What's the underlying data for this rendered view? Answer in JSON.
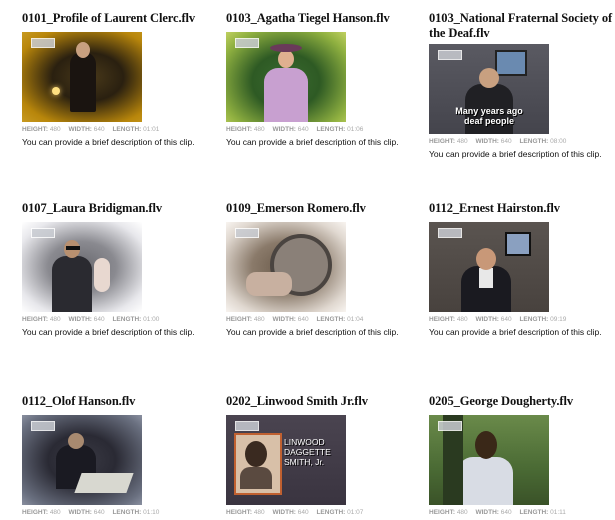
{
  "labels": {
    "height": "HEIGHT:",
    "width": "WIDTH:",
    "length": "LENGTH:"
  },
  "clips": [
    {
      "title": "0101_Profile of Laurent Clerc.flv",
      "height": "480",
      "width": "640",
      "length": "01:01",
      "description": "You can provide a brief description of this clip.",
      "caption": ""
    },
    {
      "title": "0103_Agatha Tiegel Hanson.flv",
      "height": "480",
      "width": "640",
      "length": "01:06",
      "description": "You can provide a brief description of this clip.",
      "caption": ""
    },
    {
      "title": "0103_National Fraternal Society of the Deaf.flv",
      "height": "480",
      "width": "640",
      "length": "08:00",
      "description": "You can provide a brief description of this clip.",
      "caption": "Many years ago deaf people"
    },
    {
      "title": "0107_Laura Bridigman.flv",
      "height": "480",
      "width": "640",
      "length": "01:00",
      "description": "You can provide a brief description of this clip.",
      "caption": ""
    },
    {
      "title": "0109_Emerson Romero.flv",
      "height": "480",
      "width": "640",
      "length": "01:04",
      "description": "You can provide a brief description of this clip.",
      "caption": ""
    },
    {
      "title": "0112_Ernest Hairston.flv",
      "height": "480",
      "width": "640",
      "length": "09:19",
      "description": "You can provide a brief description of this clip.",
      "caption": ""
    },
    {
      "title": "0112_Olof Hanson.flv",
      "height": "480",
      "width": "640",
      "length": "01:10",
      "description": "",
      "caption": ""
    },
    {
      "title": "0202_Linwood Smith Jr.flv",
      "height": "480",
      "width": "640",
      "length": "01:07",
      "description": "",
      "caption": "LINWOOD DAGGETTE SMITH, Jr."
    },
    {
      "title": "0205_George Dougherty.flv",
      "height": "480",
      "width": "640",
      "length": "01:11",
      "description": "",
      "caption": ""
    }
  ]
}
